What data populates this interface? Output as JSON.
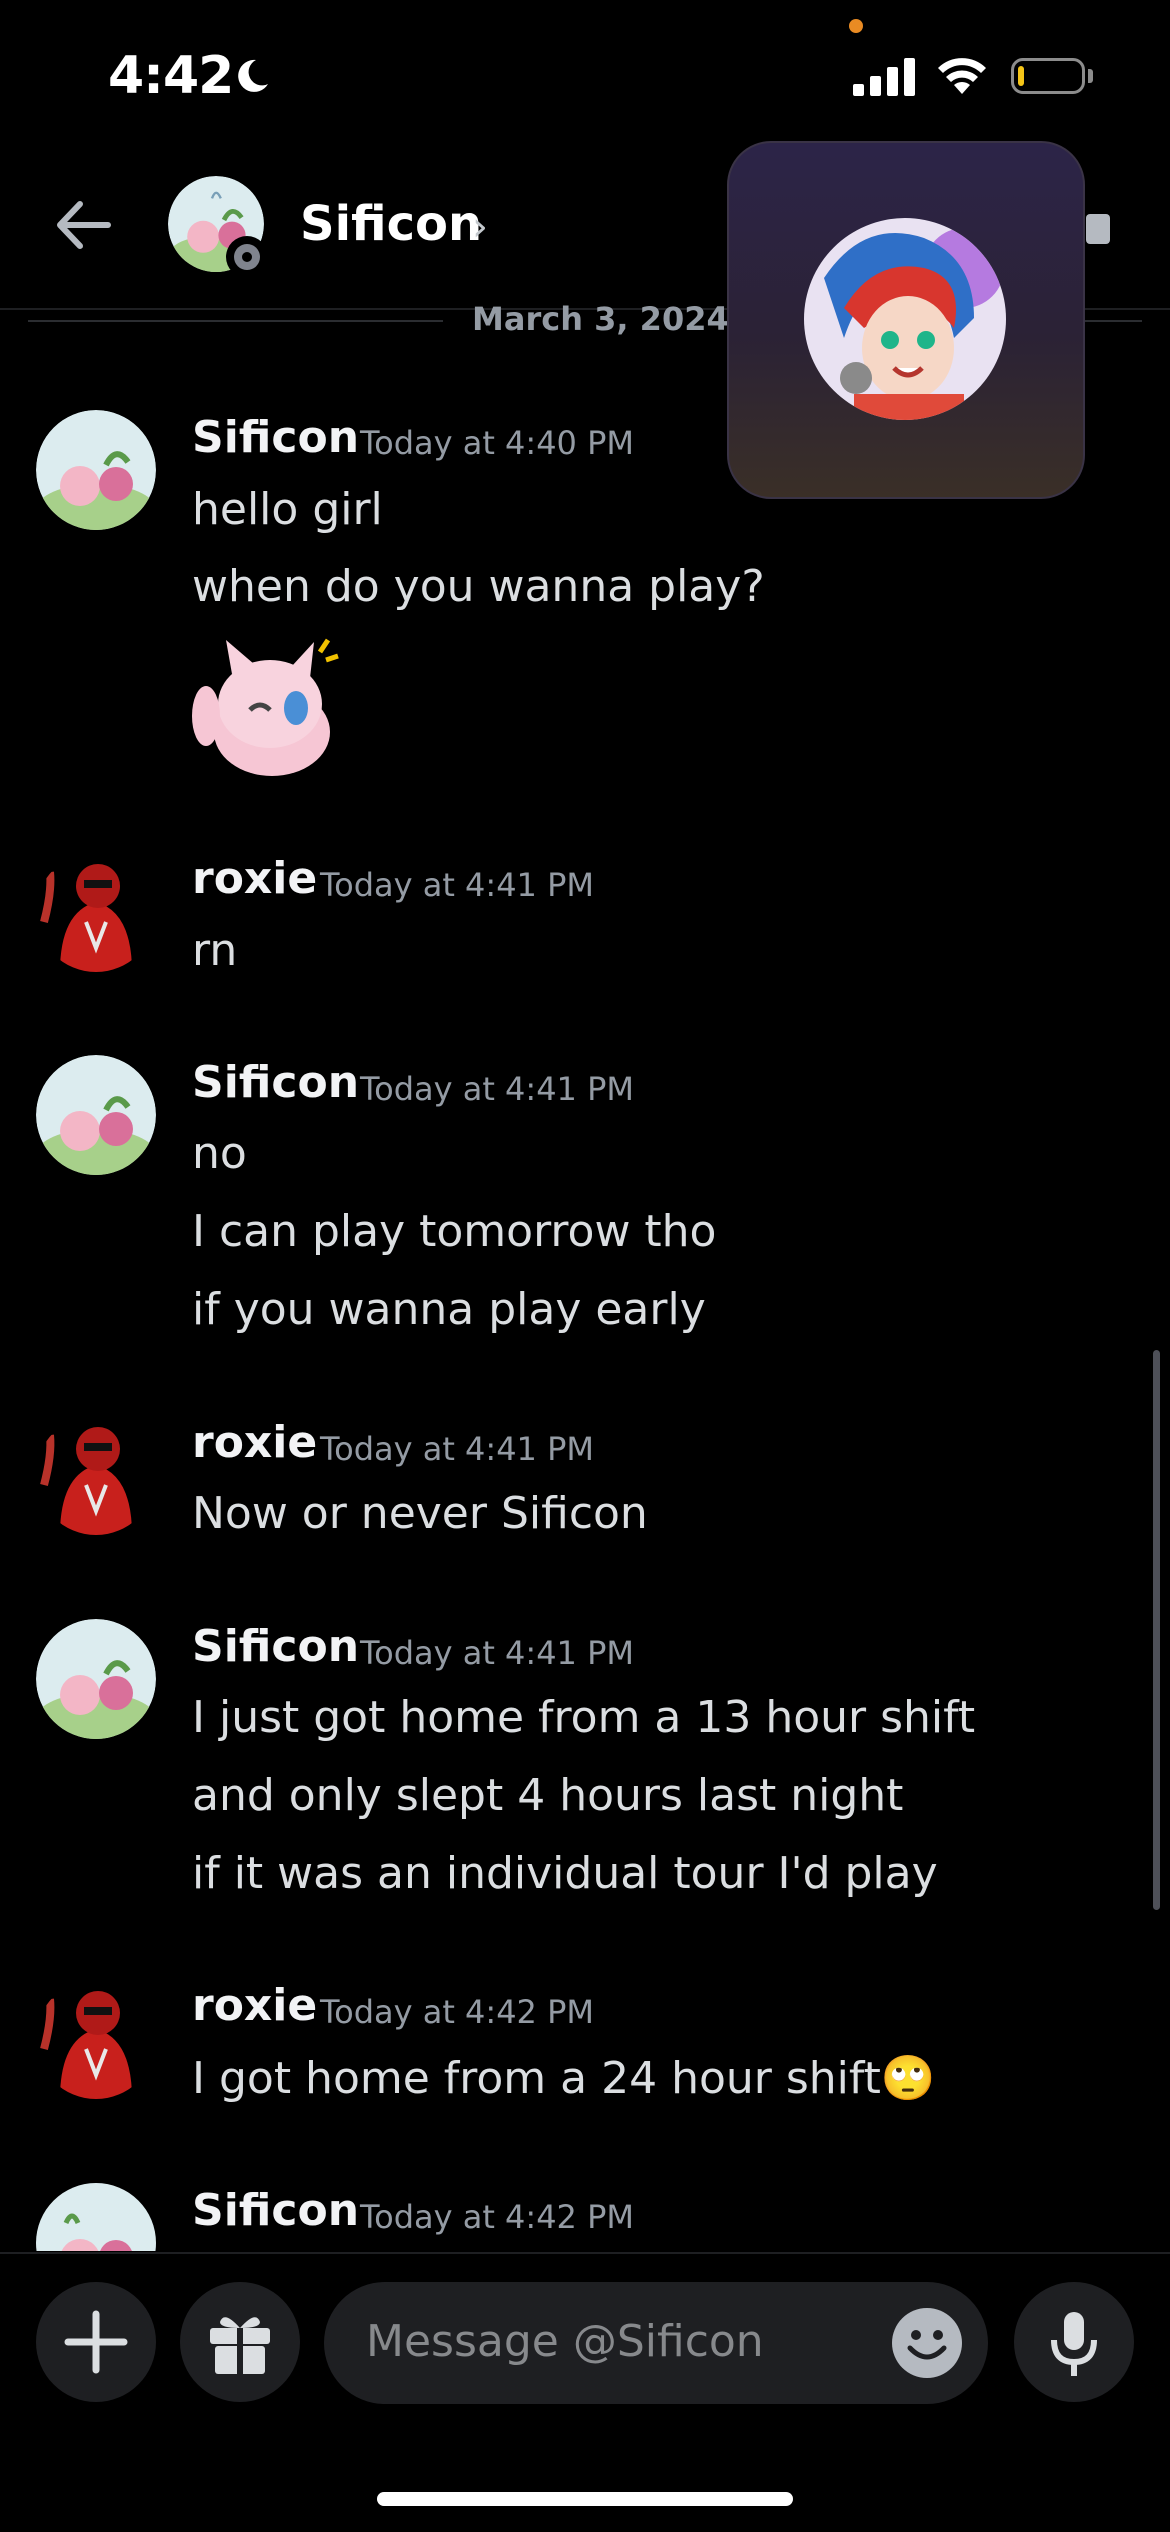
{
  "status_bar": {
    "time": "4:42"
  },
  "header": {
    "name": "Sificon"
  },
  "date_divider": "March 3, 2024",
  "messages": [
    {
      "author": "Sificon",
      "time": "Today at 4:40 PM",
      "lines": [
        "hello girl",
        "when do you wanna play?"
      ],
      "sticker": "waving-pink-cat-sticker"
    },
    {
      "author": "roxie",
      "time": "Today at 4:41 PM",
      "lines": [
        "rn"
      ]
    },
    {
      "author": "Sificon",
      "time": "Today at 4:41 PM",
      "lines": [
        "no",
        "I can play tomorrow tho",
        "if you wanna play early"
      ]
    },
    {
      "author": "roxie",
      "time": "Today at 4:41 PM",
      "lines": [
        "Now or never Sificon"
      ]
    },
    {
      "author": "Sificon",
      "time": "Today at 4:41 PM",
      "lines": [
        "I just got home from a 13 hour shift",
        "and only slept 4 hours last night",
        "if it was an individual tour I'd play"
      ]
    },
    {
      "author": "roxie",
      "time": "Today at 4:42 PM",
      "lines": [
        "I got home from a 24 hour shift🙄"
      ]
    },
    {
      "author": "Sificon",
      "time": "Today at 4:42 PM",
      "lines": []
    }
  ],
  "composer": {
    "placeholder": "Message @Sificon"
  },
  "colors": {
    "background": "#000000",
    "input_bg": "#1e1f22",
    "timestamp": "#949ba4",
    "status_offline": "#80848e"
  },
  "icons": [
    "back-arrow-icon",
    "chevron-right-icon",
    "plus-icon",
    "gift-icon",
    "emoji-icon",
    "microphone-icon",
    "moon-icon",
    "signal-icon",
    "wifi-icon",
    "battery-icon"
  ]
}
